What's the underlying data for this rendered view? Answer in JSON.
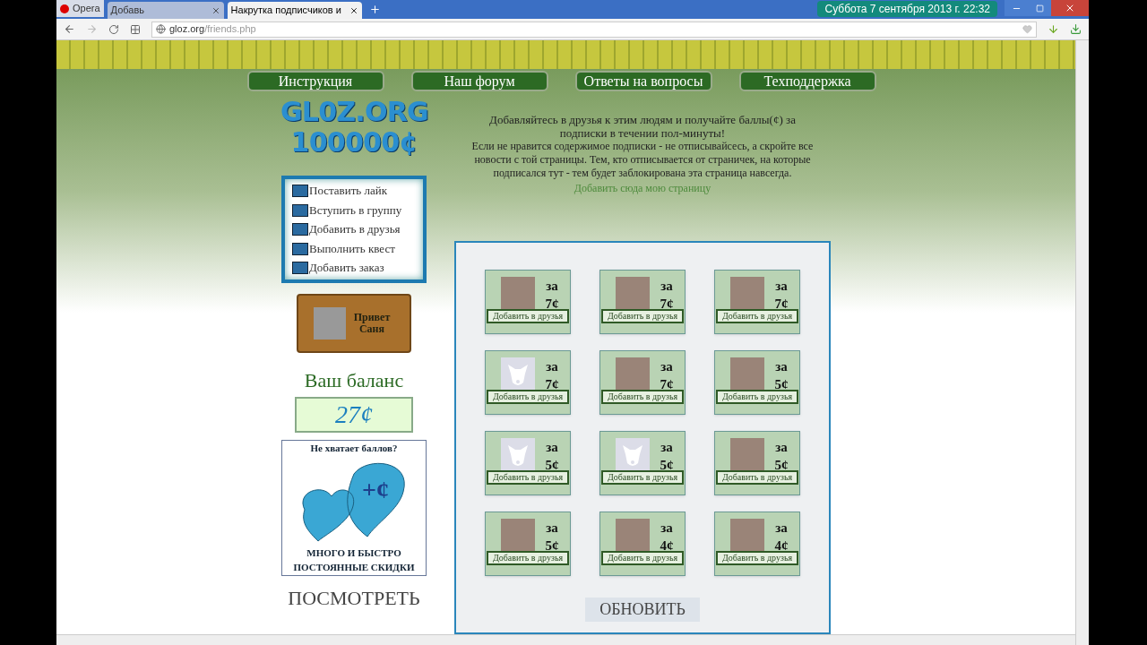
{
  "browser": {
    "menu_label": "Opera",
    "tabs": [
      {
        "label": "Добавь",
        "selected": false
      },
      {
        "label": "Накрутка подписчиков и",
        "selected": true
      }
    ],
    "clock": "Суббота  7 сентября 2013 г.  22:32",
    "url_host": "gloz.org",
    "url_path": "/friends.php"
  },
  "nav": [
    "Инструкция",
    "Наш форум",
    "Ответы на вопросы",
    "Техподдержка"
  ],
  "logo": {
    "line_1": "GL0Z.ORG",
    "line_2": "100000¢"
  },
  "intro": {
    "lead": "Добавляйтесь в друзья к этим людям и получайте баллы(¢) за подписки в течении пол-минуты!",
    "warning": "Если не нравится содержимое подписки - не отписывайсесь, а скройте все новости с той страницы. Тем, кто отписывается от страничек, на которые подписался тут - тем будет заблокирована эта страница навсегда.",
    "link": "Добавить сюда мою страницу"
  },
  "menu": [
    "Поставить лайк",
    "Вступить в группу",
    "Добавить в друзья",
    "Выполнить квест",
    "Добавить заказ"
  ],
  "greeting": "Привет Саня",
  "balance": {
    "label": "Ваш баланс",
    "value": "27¢"
  },
  "promo": {
    "title": "Не хватает баллов?",
    "symbol": "+¢",
    "line_1": "МНОГО И БЫСТРО",
    "line_2": "ПОСТОЯННЫЕ СКИДКИ"
  },
  "view_button": "ПОСМОТРЕТЬ",
  "cards": [
    {
      "kind": "photo",
      "for": "за",
      "price": "7¢",
      "button": "Добавить в друзья"
    },
    {
      "kind": "photo",
      "for": "за",
      "price": "7¢",
      "button": "Добавить в друзья"
    },
    {
      "kind": "photo",
      "for": "за",
      "price": "7¢",
      "button": "Добавить в друзья"
    },
    {
      "kind": "default",
      "for": "за",
      "price": "7¢",
      "button": "Добавить в друзья"
    },
    {
      "kind": "photo",
      "for": "за",
      "price": "7¢",
      "button": "Добавить в друзья"
    },
    {
      "kind": "photo",
      "for": "за",
      "price": "5¢",
      "button": "Добавить в друзья"
    },
    {
      "kind": "default",
      "for": "за",
      "price": "5¢",
      "button": "Добавить в друзья"
    },
    {
      "kind": "default",
      "for": "за",
      "price": "5¢",
      "button": "Добавить в друзья"
    },
    {
      "kind": "photo",
      "for": "за",
      "price": "5¢",
      "button": "Добавить в друзья"
    },
    {
      "kind": "photo",
      "for": "за",
      "price": "5¢",
      "button": "Добавить в друзья"
    },
    {
      "kind": "photo",
      "for": "за",
      "price": "4¢",
      "button": "Добавить в друзья"
    },
    {
      "kind": "photo",
      "for": "за",
      "price": "4¢",
      "button": "Добавить в друзья"
    }
  ],
  "refresh_button": "ОБНОВИТЬ"
}
